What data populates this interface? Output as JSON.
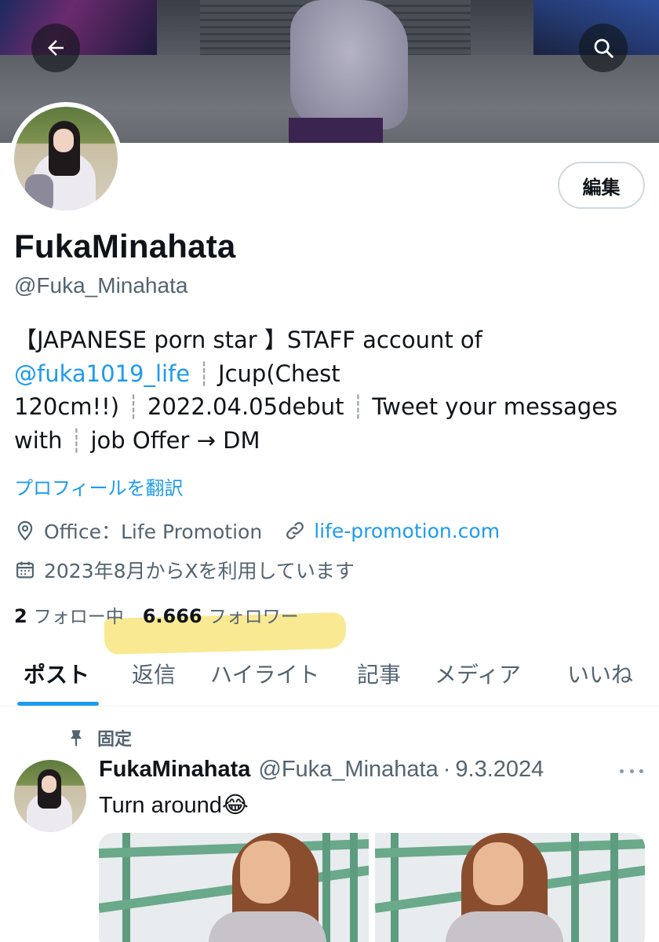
{
  "header": {
    "back_icon": "arrow-left-icon",
    "search_icon": "search-icon"
  },
  "profile": {
    "edit_label": "編集",
    "display_name": "FukaMinahata",
    "handle": "@Fuka_Minahata",
    "bio": {
      "line1": "【JAPANESE porn star 】STAFF account of",
      "mention": "@fuka1019_life",
      "line2_rest": "Jcup(Chest",
      "line3_a": "120cm!!)",
      "line3_b": "2022.04.05debut",
      "line3_c": "Tweet your messages",
      "line4_a": "with",
      "line4_b": "job Offer → DM",
      "separator": "┊"
    },
    "translate_label": "プロフィールを翻訳",
    "location": "Office：Life Promotion",
    "website": "life-promotion.com",
    "joined": "2023年8月からXを利用しています",
    "following_count": "2",
    "following_label": "フォロー中",
    "followers_count": "6.666",
    "followers_label": "フォロワー",
    "highlight_color": "#f7e06a"
  },
  "tabs": [
    {
      "label": "ポスト",
      "active": true
    },
    {
      "label": "返信",
      "active": false
    },
    {
      "label": "ハイライト",
      "active": false
    },
    {
      "label": "記事",
      "active": false
    },
    {
      "label": "メディア",
      "active": false
    },
    {
      "label": "いいね",
      "active": false
    }
  ],
  "pinned_post": {
    "pinned_label": "固定",
    "author_name": "FukaMinahata",
    "author_handle": "@Fuka_Minahata",
    "separator": "·",
    "date": "9.3.2024",
    "text": "Turn around😂",
    "more_icon": "more-dots-icon",
    "media_count": 2
  },
  "colors": {
    "accent": "#1d9bf0",
    "text_primary": "#0f1419",
    "text_secondary": "#536471"
  }
}
